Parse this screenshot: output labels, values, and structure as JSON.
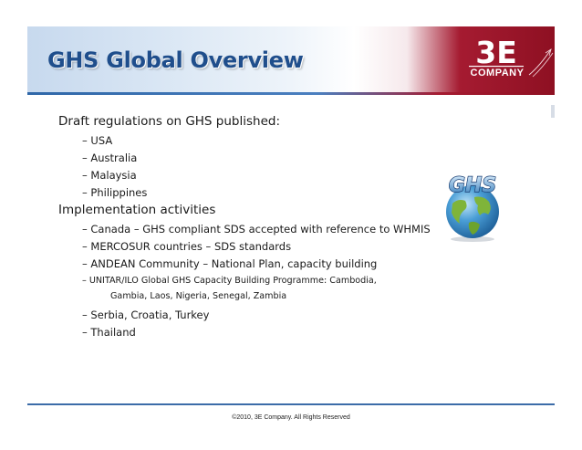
{
  "slide": {
    "title": "GHS Global Overview",
    "logo": {
      "mark": "3E",
      "name": "COMPANY"
    },
    "sections": [
      {
        "heading": "Draft regulations on GHS published:",
        "items": [
          "– USA",
          "– Australia",
          "– Malaysia",
          "– Philippines"
        ]
      },
      {
        "heading": "Implementation activities",
        "items": [
          "– Canada – GHS compliant SDS accepted with reference to WHMIS",
          "– MERCOSUR countries – SDS standards",
          "– ANDEAN Community – National Plan, capacity building"
        ],
        "unitar_item": {
          "line1": "– UNITAR/ILO Global GHS Capacity Building Programme: Cambodia,",
          "line2": "Gambia, Laos, Nigeria, Senegal, Zambia"
        },
        "items_after": [
          "– Serbia, Croatia, Turkey",
          "– Thailand"
        ]
      }
    ],
    "globe_label": "GHS",
    "footer": "©2010, 3E Company. All Rights Reserved",
    "colors": {
      "title_blue": "#1f4e8c",
      "brand_red": "#a51b31",
      "rule_blue": "#3c6ca8"
    }
  }
}
